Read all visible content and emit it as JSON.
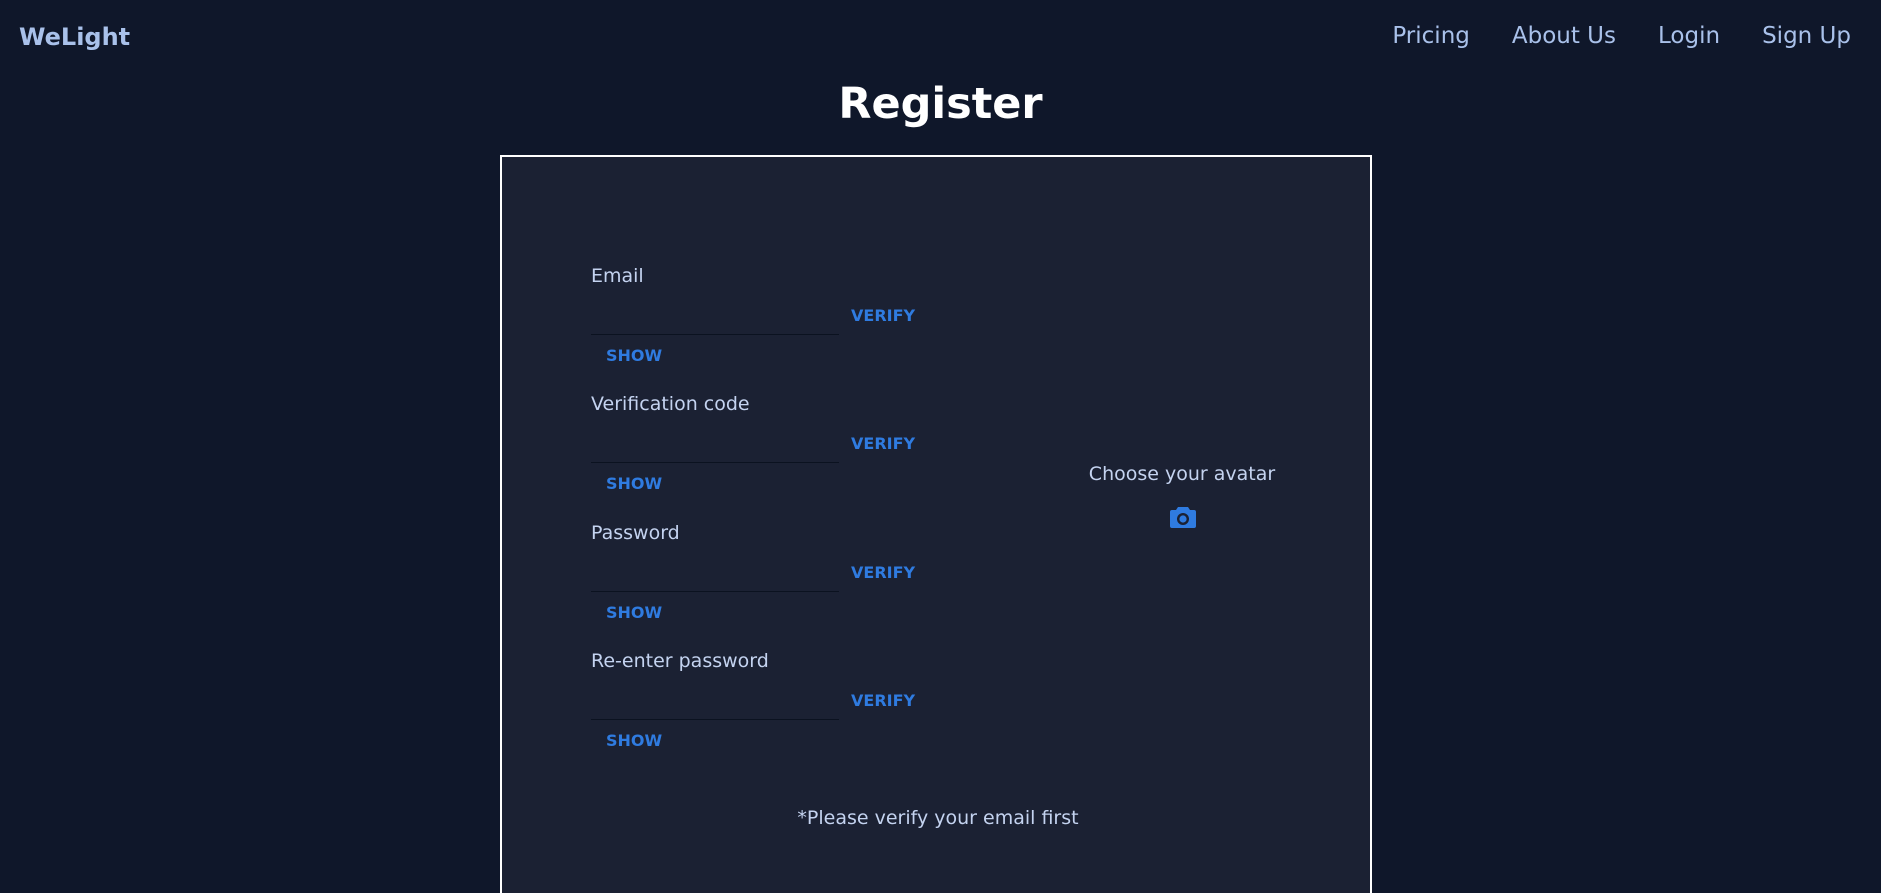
{
  "nav": {
    "brand": "WeLight",
    "links": [
      "Pricing",
      "About Us",
      "Login",
      "Sign Up"
    ]
  },
  "page_title": "Register",
  "form": {
    "fields": [
      {
        "label": "Email",
        "value": "",
        "verify_label": "VERIFY",
        "show_label": "SHOW"
      },
      {
        "label": "Verification code",
        "value": "",
        "verify_label": "VERIFY",
        "show_label": "SHOW"
      },
      {
        "label": "Password",
        "value": "",
        "verify_label": "VERIFY",
        "show_label": "SHOW"
      },
      {
        "label": "Re-enter password",
        "value": "",
        "verify_label": "VERIFY",
        "show_label": "SHOW"
      }
    ],
    "avatar_label": "Choose your avatar",
    "avatar_icon": "camera-icon",
    "notice": "*Please verify your email first"
  },
  "colors": {
    "background": "#0f172a",
    "card": "#1b2133",
    "accent": "#2f7be0",
    "nav_text": "#a9c1ea"
  }
}
